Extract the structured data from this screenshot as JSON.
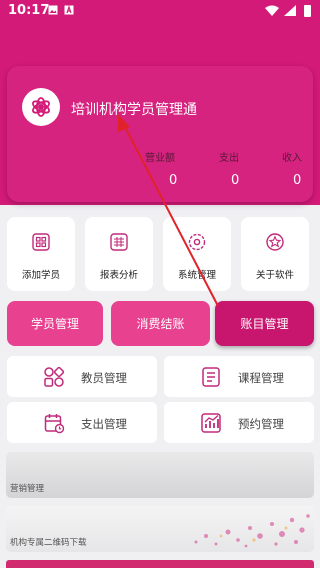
{
  "status_bar": {
    "time": "10:17",
    "icons": [
      "image-icon",
      "a-font-icon",
      "wifi-icon",
      "signal-icon",
      "battery-icon"
    ]
  },
  "header": {
    "title": "培训机构学员管理通",
    "logo_icon": "flower-logo-icon",
    "stats": [
      {
        "label": "营业额",
        "value": "0"
      },
      {
        "label": "支出",
        "value": "0"
      },
      {
        "label": "收入",
        "value": "0"
      }
    ]
  },
  "quick_tiles": [
    {
      "label": "添加学员",
      "icon": "add-student-icon"
    },
    {
      "label": "报表分析",
      "icon": "report-icon"
    },
    {
      "label": "系统管理",
      "icon": "gear-icon"
    },
    {
      "label": "关于软件",
      "icon": "star-icon"
    }
  ],
  "primary_buttons": [
    "学员管理",
    "消费结账",
    "账目管理"
  ],
  "menu_buttons": [
    {
      "label": "教员管理",
      "icon": "teacher-grid-icon"
    },
    {
      "label": "课程管理",
      "icon": "course-doc-icon"
    },
    {
      "label": "支出管理",
      "icon": "calendar-expense-icon"
    },
    {
      "label": "预约管理",
      "icon": "chart-booking-icon"
    }
  ],
  "banners": [
    "营销管理",
    "机构专属二维码下载"
  ],
  "colors": {
    "brand": "#d41a78",
    "button_light": "#e8418f",
    "button_dark": "#c8166f",
    "icon": "#c02a7a",
    "arrow": "#e0222a"
  }
}
